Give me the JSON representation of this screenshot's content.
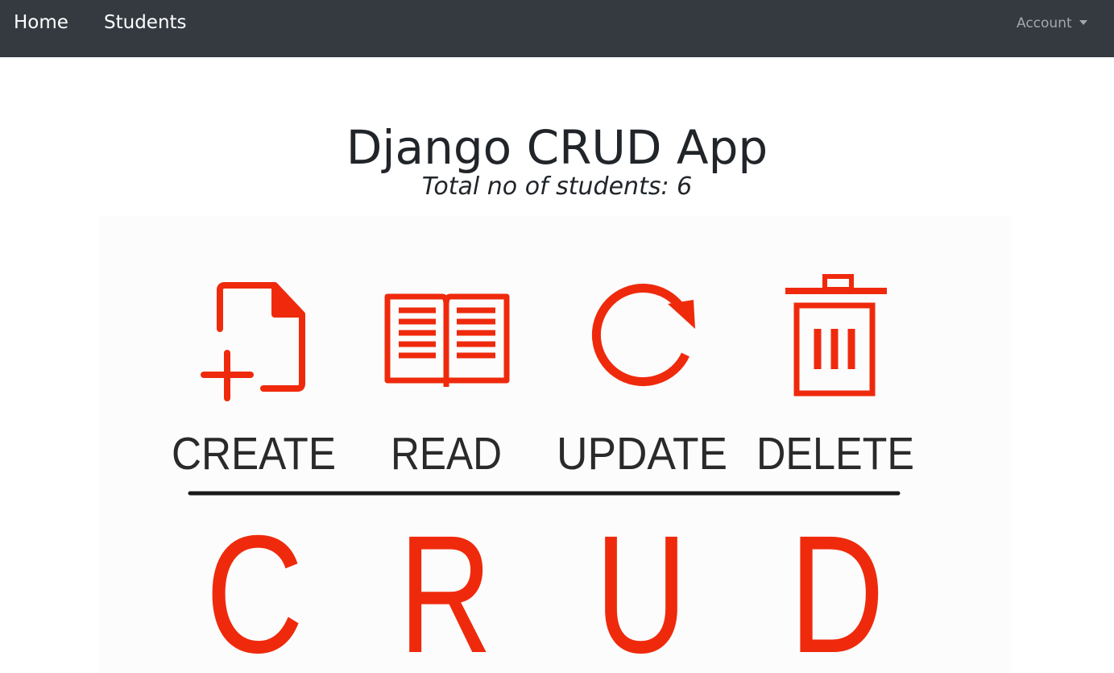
{
  "nav": {
    "links": [
      {
        "label": "Home"
      },
      {
        "label": "Students"
      }
    ],
    "account_label": "Account"
  },
  "main": {
    "title": "Django CRUD App",
    "student_count_text": "Total no of students: 6"
  },
  "banner": {
    "labels": [
      "CREATE",
      "READ",
      "UPDATE",
      "DELETE"
    ],
    "letters": [
      "C",
      "R",
      "U",
      "D"
    ],
    "icons": [
      "file-add-icon",
      "open-book-icon",
      "refresh-icon",
      "trash-icon"
    ],
    "accent_color": "#ef2a0c",
    "text_color": "#2a2a2a"
  },
  "colors": {
    "navbar_bg": "#343a40",
    "text": "#212529"
  }
}
